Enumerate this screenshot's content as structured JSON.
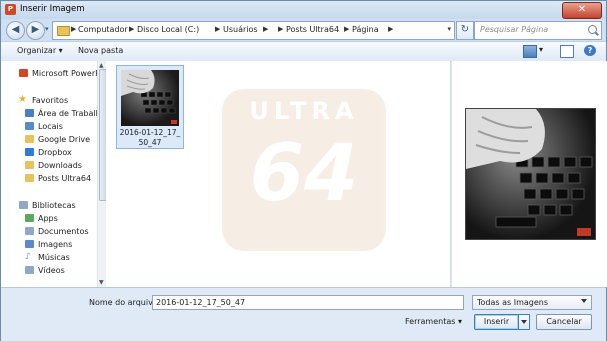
{
  "window": {
    "title": "Inserir Imagem",
    "app_icon_letter": "P",
    "close_glyph": "✕"
  },
  "nav": {
    "back_glyph": "◀",
    "forward_glyph": "▶",
    "recent_glyph": "▾",
    "breadcrumb": [
      "Computador",
      "Disco Local (C:)",
      "Usuários",
      "Posts Ultra64",
      "Página"
    ],
    "refresh_glyph": "↻",
    "search_placeholder": "Pesquisar Página"
  },
  "toolbar": {
    "organize_label": "Organizar ▾",
    "new_folder_label": "Nova pasta",
    "help_glyph": "?"
  },
  "sidebar": {
    "items": [
      {
        "label": "Microsoft PowerPoint",
        "icon": "powerpoint-icon",
        "color": "#d24726",
        "indent": false
      },
      {
        "label": "Favoritos",
        "icon": "star-icon",
        "color": "#e2b23a",
        "indent": false
      },
      {
        "label": "Área de Trabalho",
        "icon": "desktop-icon",
        "color": "#4a7fc1",
        "indent": true
      },
      {
        "label": "Locais",
        "icon": "places-icon",
        "color": "#5a8bc6",
        "indent": true
      },
      {
        "label": "Google Drive",
        "icon": "google-drive-icon",
        "color": "#e8c25a",
        "indent": true
      },
      {
        "label": "Dropbox",
        "icon": "dropbox-icon",
        "color": "#2f7cd6",
        "indent": true
      },
      {
        "label": "Downloads",
        "icon": "downloads-icon",
        "color": "#e8c25a",
        "indent": true
      },
      {
        "label": "Posts Ultra64",
        "icon": "folder-icon",
        "color": "#e8c25a",
        "indent": true
      },
      {
        "label": "Bibliotecas",
        "icon": "library-icon",
        "color": "#8fa8c8",
        "indent": false
      },
      {
        "label": "Apps",
        "icon": "apps-icon",
        "color": "#5ea85e",
        "indent": true
      },
      {
        "label": "Documentos",
        "icon": "documents-icon",
        "color": "#8fa8c8",
        "indent": true
      },
      {
        "label": "Imagens",
        "icon": "images-icon",
        "color": "#5a8bc6",
        "indent": true
      },
      {
        "label": "Músicas",
        "icon": "music-icon",
        "color": "#6a9ad6",
        "indent": true
      },
      {
        "label": "Vídeos",
        "icon": "videos-icon",
        "color": "#8fa8c8",
        "indent": true
      }
    ]
  },
  "content": {
    "watermark_line1": "ULTRA",
    "watermark_line2": "64",
    "files": [
      {
        "name": "2016-01-12_17_50_47",
        "selected": true
      }
    ]
  },
  "bottom": {
    "filename_label": "Nome do arquivo:",
    "filename_value": "2016-01-12_17_50_47",
    "filter_value": "Todas as Imagens",
    "tools_label": "Ferramentas ▾",
    "insert_label": "Inserir",
    "cancel_label": "Cancelar"
  },
  "colors": {
    "accent": "#3c7fb1",
    "selection": "#dbe9f9",
    "chrome": "#dfeaf6"
  }
}
